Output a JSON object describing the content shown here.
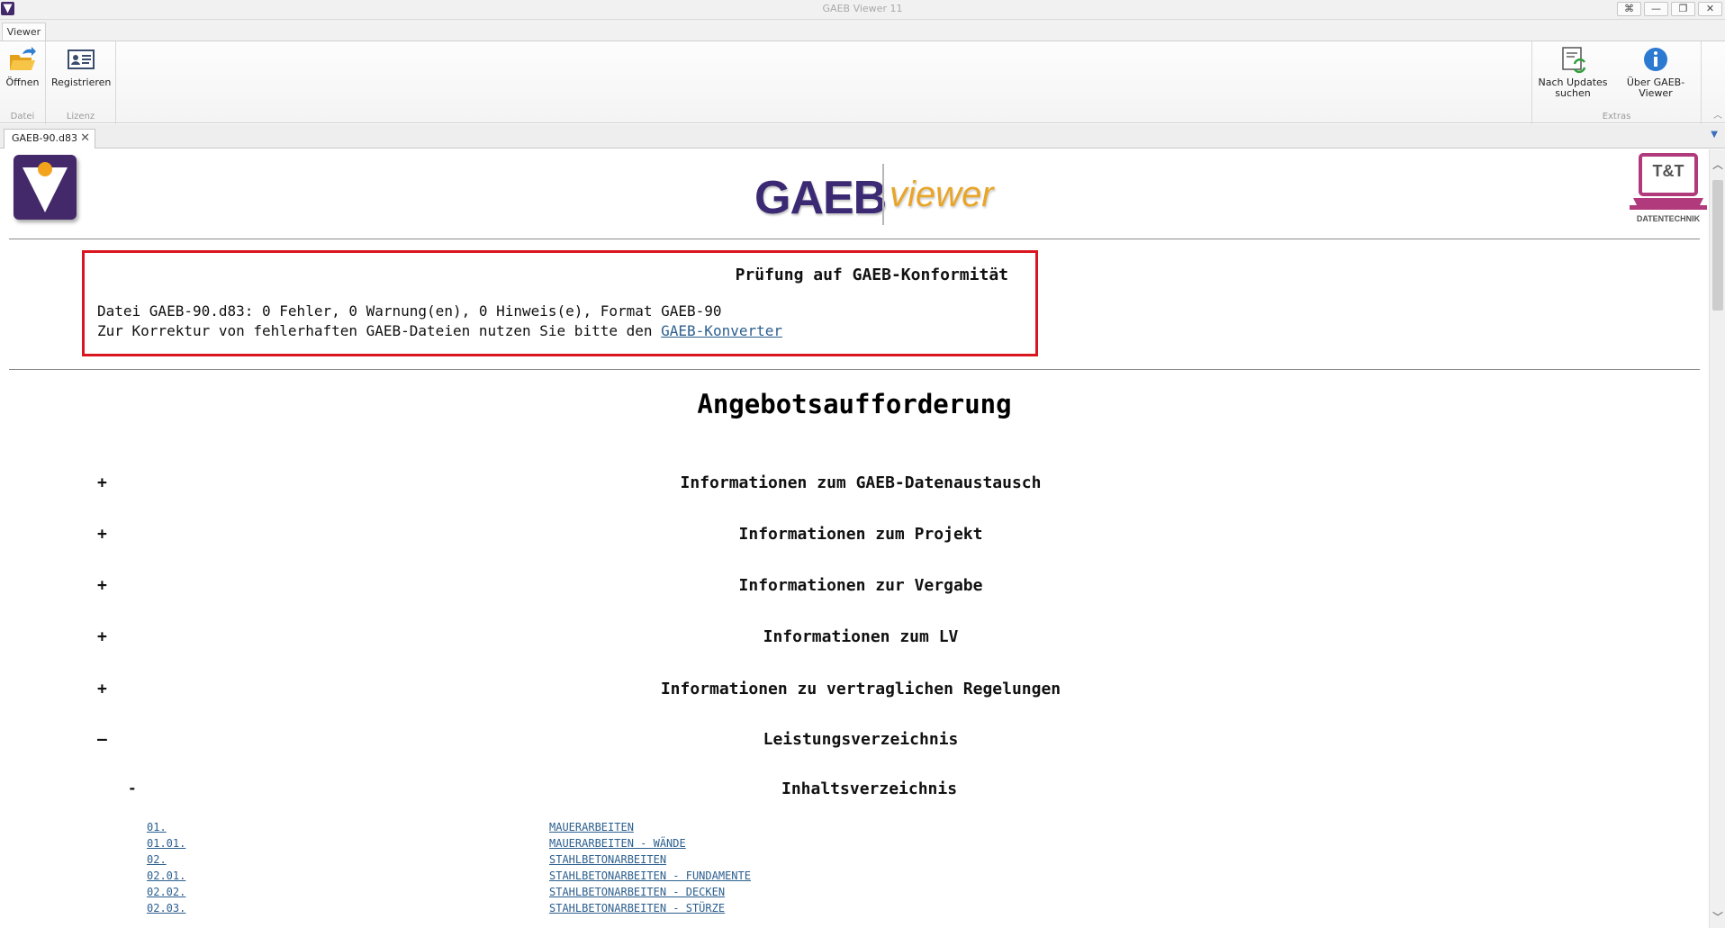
{
  "window": {
    "title": "GAEB Viewer 11",
    "buttons": [
      "⌘",
      "—",
      "❐",
      "✕"
    ]
  },
  "ribbon": {
    "tab_label": "Viewer",
    "groups": [
      {
        "label": "Datei",
        "buttons": [
          {
            "label": "Öffnen",
            "icon": "open-folder-icon"
          }
        ]
      },
      {
        "label": "Lizenz",
        "buttons": [
          {
            "label": "Registrieren",
            "icon": "id-card-icon"
          }
        ]
      },
      {
        "label": "Extras",
        "buttons": [
          {
            "label_line1": "Nach Updates",
            "label_line2": "suchen",
            "icon": "update-check-icon"
          },
          {
            "label": "Über GAEB-Viewer",
            "icon": "info-icon"
          }
        ]
      }
    ]
  },
  "document_tab": {
    "label": "GAEB-90.d83"
  },
  "content": {
    "brand": {
      "gaeb": "GAEB",
      "viewer": "viewer",
      "tt_label": "T&T",
      "tt_sub": "DATENTECHNIK"
    },
    "conformity": {
      "title": "Prüfung auf GAEB-Konformität",
      "line1": "Datei GAEB-90.d83: 0 Fehler, 0 Warnung(en), 0 Hinweis(e), Format GAEB-90",
      "line2_prefix": "Zur Korrektur von fehlerhaften GAEB-Dateien nutzen Sie bitte den ",
      "line2_link": "GAEB-Konverter"
    },
    "heading": "Angebotsaufforderung",
    "sections": [
      {
        "toggle": "+",
        "title": "Informationen zum GAEB-Datenaustausch"
      },
      {
        "toggle": "+",
        "title": "Informationen zum Projekt"
      },
      {
        "toggle": "+",
        "title": "Informationen zur Vergabe"
      },
      {
        "toggle": "+",
        "title": "Informationen zum LV"
      },
      {
        "toggle": "+",
        "title": "Informationen zu vertraglichen Regelungen"
      },
      {
        "toggle": "–",
        "title": "Leistungsverzeichnis"
      }
    ],
    "toc": {
      "toggle": "-",
      "title": "Inhaltsverzeichnis",
      "rows": [
        {
          "num": "01.",
          "text": "MAUERARBEITEN"
        },
        {
          "num": "01.01.",
          "text": "MAUERARBEITEN - WÄNDE"
        },
        {
          "num": "02.",
          "text": "STAHLBETONARBEITEN"
        },
        {
          "num": "02.01.",
          "text": "STAHLBETONARBEITEN - FUNDAMENTE"
        },
        {
          "num": "02.02.",
          "text": "STAHLBETONARBEITEN - DECKEN"
        },
        {
          "num": "02.03.",
          "text": "STAHLBETONARBEITEN - STÜRZE"
        }
      ]
    }
  },
  "colors": {
    "accent_red": "#d9161f",
    "brand_purple": "#43286a",
    "link_blue": "#2c5f8f",
    "viewer_orange": "#e8a52a"
  }
}
